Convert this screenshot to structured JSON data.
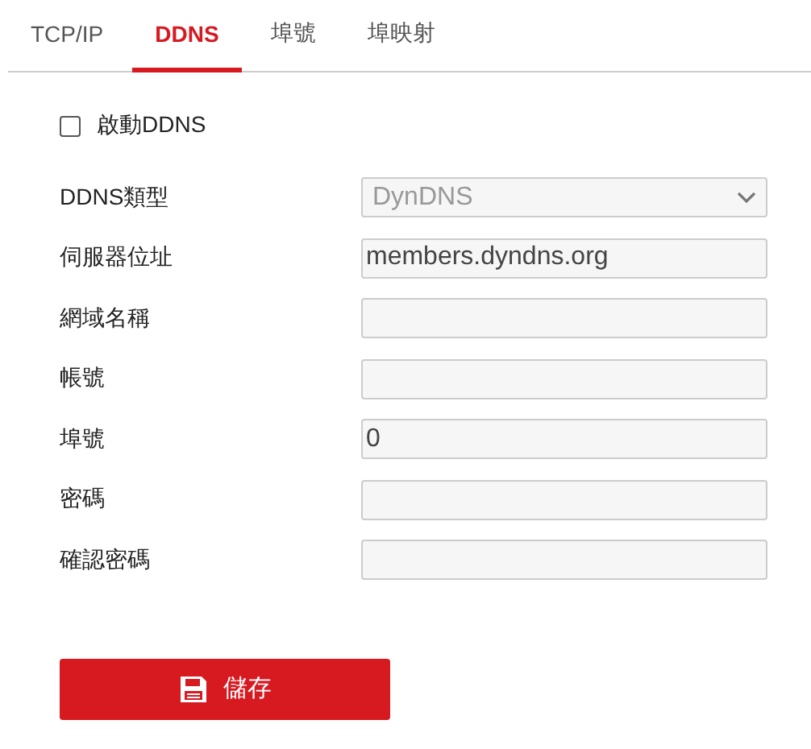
{
  "tabs": [
    {
      "label": "TCP/IP",
      "selected": false
    },
    {
      "label": "DDNS",
      "selected": true
    },
    {
      "label": "埠號",
      "selected": false
    },
    {
      "label": "埠映射",
      "selected": false
    }
  ],
  "enable": {
    "label": "啟動DDNS",
    "checked": false
  },
  "fields": [
    {
      "label": "DDNS類型",
      "kind": "select",
      "value": "DynDNS"
    },
    {
      "label": "伺服器位址",
      "kind": "text",
      "value": "members.dyndns.org"
    },
    {
      "label": "網域名稱",
      "kind": "text"
    },
    {
      "label": "帳號",
      "kind": "text"
    },
    {
      "label": "埠號",
      "kind": "text",
      "value": "0"
    },
    {
      "label": "密碼",
      "kind": "text"
    },
    {
      "label": "確認密碼",
      "kind": "text"
    }
  ],
  "save_button": {
    "label": "儲存"
  }
}
